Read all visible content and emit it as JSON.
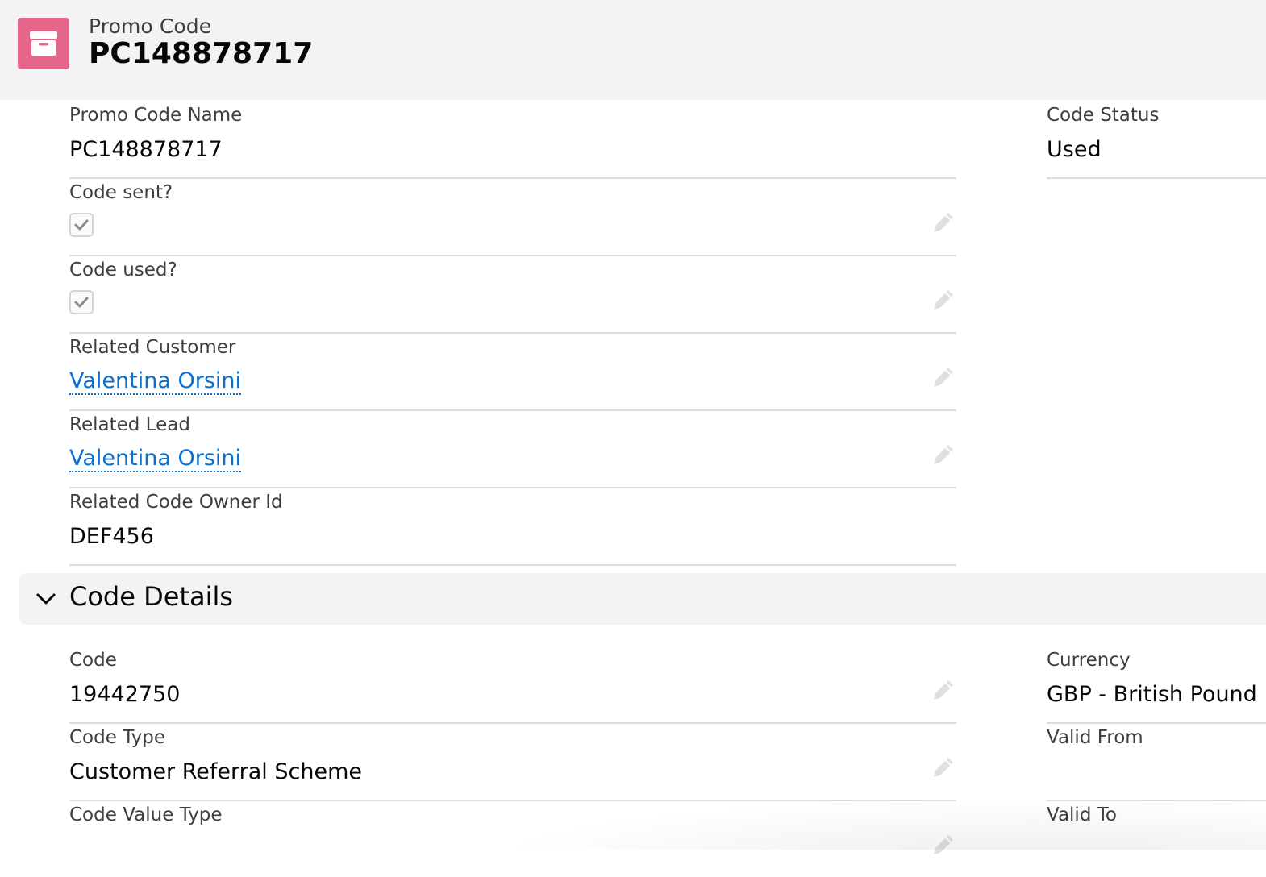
{
  "header": {
    "object_type": "Promo Code",
    "record_name": "PC148878717",
    "icon": "archive-box-icon",
    "icon_color": "#e3668a"
  },
  "fields": {
    "promo_code_name": {
      "label": "Promo Code Name",
      "value": "PC148878717"
    },
    "code_status": {
      "label": "Code Status",
      "value": "Used"
    },
    "code_sent": {
      "label": "Code sent?",
      "checked": true
    },
    "code_used": {
      "label": "Code used?",
      "checked": true
    },
    "related_customer": {
      "label": "Related Customer",
      "value": "Valentina Orsini"
    },
    "related_lead": {
      "label": "Related Lead",
      "value": "Valentina Orsini"
    },
    "related_code_owner_id": {
      "label": "Related Code Owner Id",
      "value": "DEF456"
    }
  },
  "sections": {
    "code_details": {
      "title": "Code Details",
      "expanded": true,
      "fields": {
        "code": {
          "label": "Code",
          "value": "19442750"
        },
        "currency": {
          "label": "Currency",
          "value": "GBP - British Pound"
        },
        "code_type": {
          "label": "Code Type",
          "value": "Customer Referral Scheme"
        },
        "valid_from": {
          "label": "Valid From",
          "value": ""
        },
        "code_value_type": {
          "label": "Code Value Type",
          "value": ""
        },
        "valid_to": {
          "label": "Valid To",
          "value": ""
        }
      }
    }
  },
  "colors": {
    "link": "#0b6fce",
    "header_bg": "#f3f3f3",
    "divider": "#dddbda"
  }
}
